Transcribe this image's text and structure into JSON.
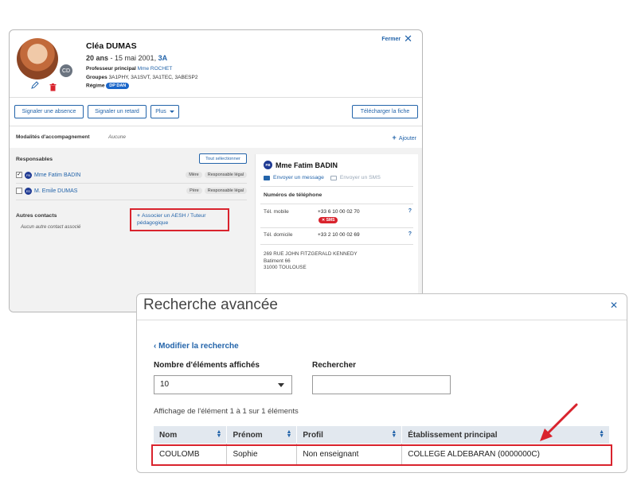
{
  "student": {
    "name": "Cléa DUMAS",
    "initials": "CD",
    "age": "20 ans",
    "birth": " - 15 mai 2001, ",
    "class": "3A",
    "prof_label": "Professeur principal",
    "prof_value": "Mme ROCHET",
    "groups_label": "Groupes",
    "groups_value": "3A1PHY, 3A1SVT, 3A1TEC, 3ABESP2",
    "regime_label": "Régime",
    "regime_value": "DP DAN",
    "close_label": "Fermer"
  },
  "actions": {
    "absence": "Signaler une absence",
    "retard": "Signaler un retard",
    "plus": "Plus",
    "telecharger": "Télécharger la fiche"
  },
  "modalites": {
    "label": "Modalités d'accompagnement",
    "value": "Aucune",
    "add": "Ajouter"
  },
  "responsables": {
    "title": "Responsables",
    "select_all": "Tout sélectionner",
    "items": [
      {
        "initials": "FB",
        "name": "Mme Fatim BADIN",
        "checked": true,
        "role": "Mère",
        "status": "Responsable légal"
      },
      {
        "initials": "ED",
        "name": "M. Emile DUMAS",
        "checked": false,
        "role": "Père",
        "status": "Responsable légal"
      }
    ]
  },
  "autres": {
    "title": "Autres contacts",
    "empty": "Aucun autre contact associé",
    "aesh_line1": "Associer un AESH / Tuteur",
    "aesh_line2": "pédagogique"
  },
  "detail": {
    "initials": "FB",
    "name": "Mme Fatim BADIN",
    "send_message": "Envoyer un message",
    "send_sms": "Envoyer un SMS",
    "phones_title": "Numéros de téléphone",
    "mobile_label": "Tél. mobile",
    "mobile_value": "+33 6 10 00 02 70",
    "sms_badge": "SMS",
    "home_label": "Tél. domicile",
    "home_value": "+33 2 10 00 02 69",
    "address_line1": "269 RUE JOHN FITZGERALD KENNEDY",
    "address_line2": "Batiment 66",
    "address_line3": "31000 TOULOUSE"
  },
  "search": {
    "title": "Recherche avancée",
    "back": "‹ Modifier la recherche",
    "count_label": "Nombre d'éléments affichés",
    "count_value": "10",
    "search_label": "Rechercher",
    "search_value": "",
    "summary": "Affichage de l'élément 1 à 1 sur 1 éléments",
    "columns": [
      "Nom",
      "Prénom",
      "Profil",
      "Établissement principal"
    ],
    "rows": [
      [
        "COULOMB",
        "Sophie",
        "Non enseignant",
        "COLLEGE ALDEBARAN (0000000C)"
      ]
    ]
  },
  "colors": {
    "accent": "#2364aa",
    "highlight": "#d9232d"
  }
}
